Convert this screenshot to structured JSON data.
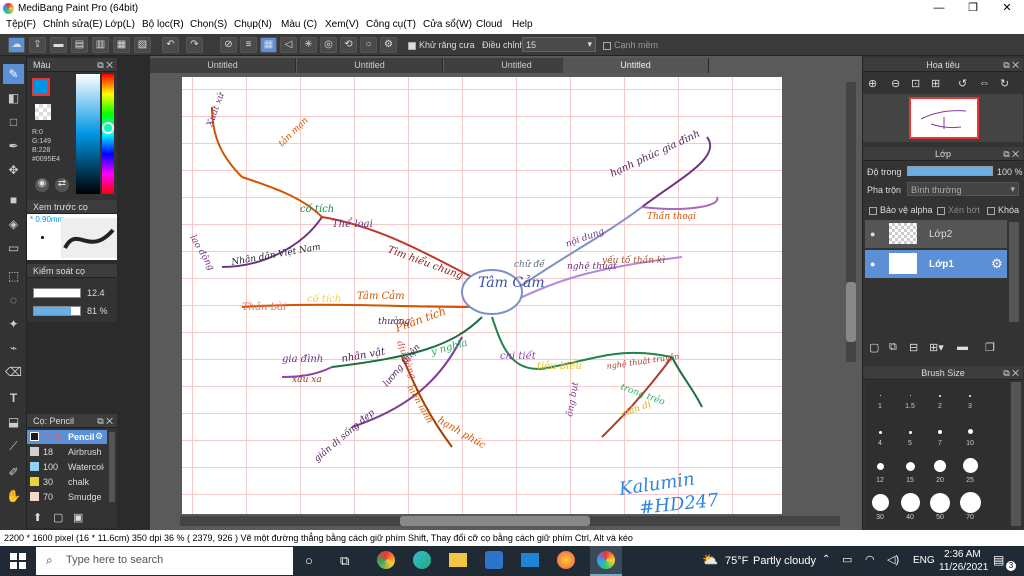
{
  "window": {
    "title": "MediBang Paint Pro (64bit)",
    "minimize": "—",
    "maximize": "❐",
    "close": "✕"
  },
  "menu": [
    "Tệp(F)",
    "Chỉnh sửa(E)",
    "Lớp(L)",
    "Bộ lọc(R)",
    "Chọn(S)",
    "Chụp(N)",
    "Màu (C)",
    "Xem(V)",
    "Công cụ(T)",
    "Cửa sổ(W)",
    "Cloud",
    "Help"
  ],
  "toolbar": {
    "antialias_label": "Khử răng cưa",
    "correction_label": "Điều chỉnh",
    "correction_value": "15",
    "smooth_label": "Cạnh mềm"
  },
  "color_panel": {
    "title": "Màu",
    "r": "R:0",
    "g": "G:149",
    "b": "B:228",
    "hex": "#0095E4",
    "main_color": "#0095E4"
  },
  "brush_preview": {
    "title": "Xem trước cọ",
    "size": "* 0.90mm"
  },
  "brush_control": {
    "title": "Kiểm soát cọ",
    "size": "12.4",
    "opacity": "81 %"
  },
  "brush_list": {
    "title": "Cọ: Pencil",
    "items": [
      {
        "size": "12.4",
        "name": "Pencil",
        "swatch": "#1a1a1a"
      },
      {
        "size": "18",
        "name": "Airbrush",
        "swatch": "#cfcfcf"
      },
      {
        "size": "100",
        "name": "Watercolor",
        "swatch": "#8fd3f4"
      },
      {
        "size": "30",
        "name": "chalk",
        "swatch": "#e7d33a"
      },
      {
        "size": "70",
        "name": "Smudge",
        "swatch": "#f4d8c4"
      }
    ]
  },
  "tabs": [
    "Untitled",
    "Untitled",
    "Untitled",
    "Untitled"
  ],
  "navigator": {
    "title": "Hoa tiêu"
  },
  "layers": {
    "title": "Lớp",
    "opacity_label": "Độ trong",
    "opacity_value": "100 %",
    "blend_label": "Pha trộn",
    "blend_value": "Bình thường",
    "protect_alpha": "Bảo vệ alpha",
    "clipping": "Xén bớt",
    "lock": "Khóa",
    "items": [
      {
        "name": "Lớp2"
      },
      {
        "name": "Lớp1"
      }
    ]
  },
  "brush_size": {
    "title": "Brush Size",
    "sizes": [
      "1",
      "1.5",
      "2",
      "3",
      "4",
      "5",
      "7",
      "10",
      "12",
      "15",
      "20",
      "25",
      "30",
      "40",
      "50",
      "70"
    ]
  },
  "status": {
    "text": "2200 * 1600 pixel   (16 * 11.6cm)   350 dpi   36 %   ( 2379, 926 )   Vẽ một đường thẳng bằng cách giữ phím Shift, Thay đổi cỡ cọ bằng cách giữ phím Ctrl, Alt và kéo"
  },
  "taskbar": {
    "search_placeholder": "Type here to search",
    "weather_temp": "75°F",
    "weather_text": "Partly cloudy",
    "lang": "ENG",
    "time": "2:36 AM",
    "date": "11/26/2021",
    "notif_count": "3"
  },
  "drawing": {
    "center": "Tâm Cảm",
    "labels": [
      "Tìm hiểu chung",
      "Thể loại",
      "cố tích",
      "Xuất xứ",
      "tản mạn",
      "Nhân dân Việt Nam",
      "lao động",
      "Thân bài",
      "cố tích",
      "Tâm Cảm",
      "nội dung",
      "nghệ thuật",
      "chữ đề",
      "hạnh phúc gia đình",
      "Thần thoại",
      "yếu tố thần kì",
      "Phân tích",
      "ý nghĩa",
      "chi tiết",
      "tiêu biểu",
      "nghệ thuật truyện",
      "trong trẻo",
      "giản dị",
      "ông bụt",
      "nhân vật",
      "gia đình",
      "xấu xa",
      "dịu dàng",
      "thường",
      "lương thiện",
      "hiền lành",
      "hạnh phúc",
      "giản dị sống đẹp"
    ],
    "signature_line1": "Kalumin",
    "signature_line2": "#HD247"
  }
}
